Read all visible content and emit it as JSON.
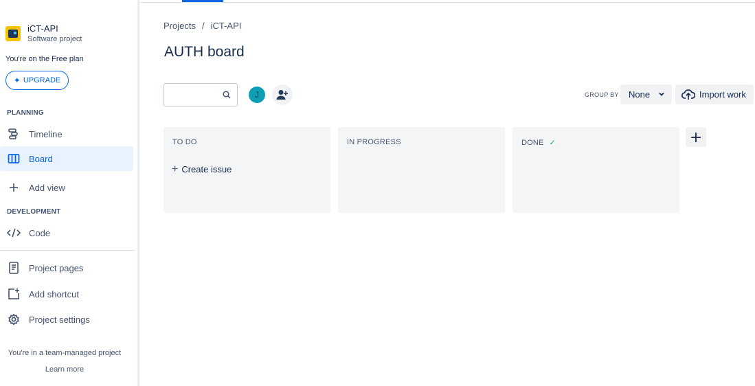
{
  "project": {
    "name": "iCT-API",
    "type": "Software project"
  },
  "plan": {
    "text": "You're on the Free plan",
    "upgrade_label": "UPGRADE"
  },
  "sidebar": {
    "sections": {
      "planning": "PLANNING",
      "development": "DEVELOPMENT"
    },
    "items": [
      {
        "label": "Timeline",
        "icon": "timeline-icon"
      },
      {
        "label": "Board",
        "icon": "board-icon",
        "active": true
      },
      {
        "label": "Add view",
        "icon": "plus-icon"
      },
      {
        "label": "Code",
        "icon": "code-icon"
      },
      {
        "label": "Project pages",
        "icon": "page-icon"
      },
      {
        "label": "Add shortcut",
        "icon": "add-shortcut-icon"
      },
      {
        "label": "Project settings",
        "icon": "gear-icon"
      }
    ],
    "footer": {
      "team_text": "You're in a team-managed project",
      "learn_more": "Learn more"
    }
  },
  "breadcrumb": {
    "items": [
      "Projects",
      "iCT-API"
    ],
    "separator": "/"
  },
  "page": {
    "title": "AUTH board"
  },
  "toolbar": {
    "search_value": "",
    "avatar_initial": "J",
    "group_by_label": "GROUP BY",
    "group_by_value": "None",
    "import_label": "Import work"
  },
  "board": {
    "columns": [
      {
        "title": "TO DO",
        "create_label": "Create issue"
      },
      {
        "title": "IN PROGRESS"
      },
      {
        "title": "DONE",
        "done": true
      }
    ]
  },
  "colors": {
    "accent": "#0c66e4",
    "active_bg": "#e9f2ff",
    "column_bg": "#f4f5f7",
    "avatar_bg": "#0f9fb4",
    "done_check": "#22a06b"
  }
}
